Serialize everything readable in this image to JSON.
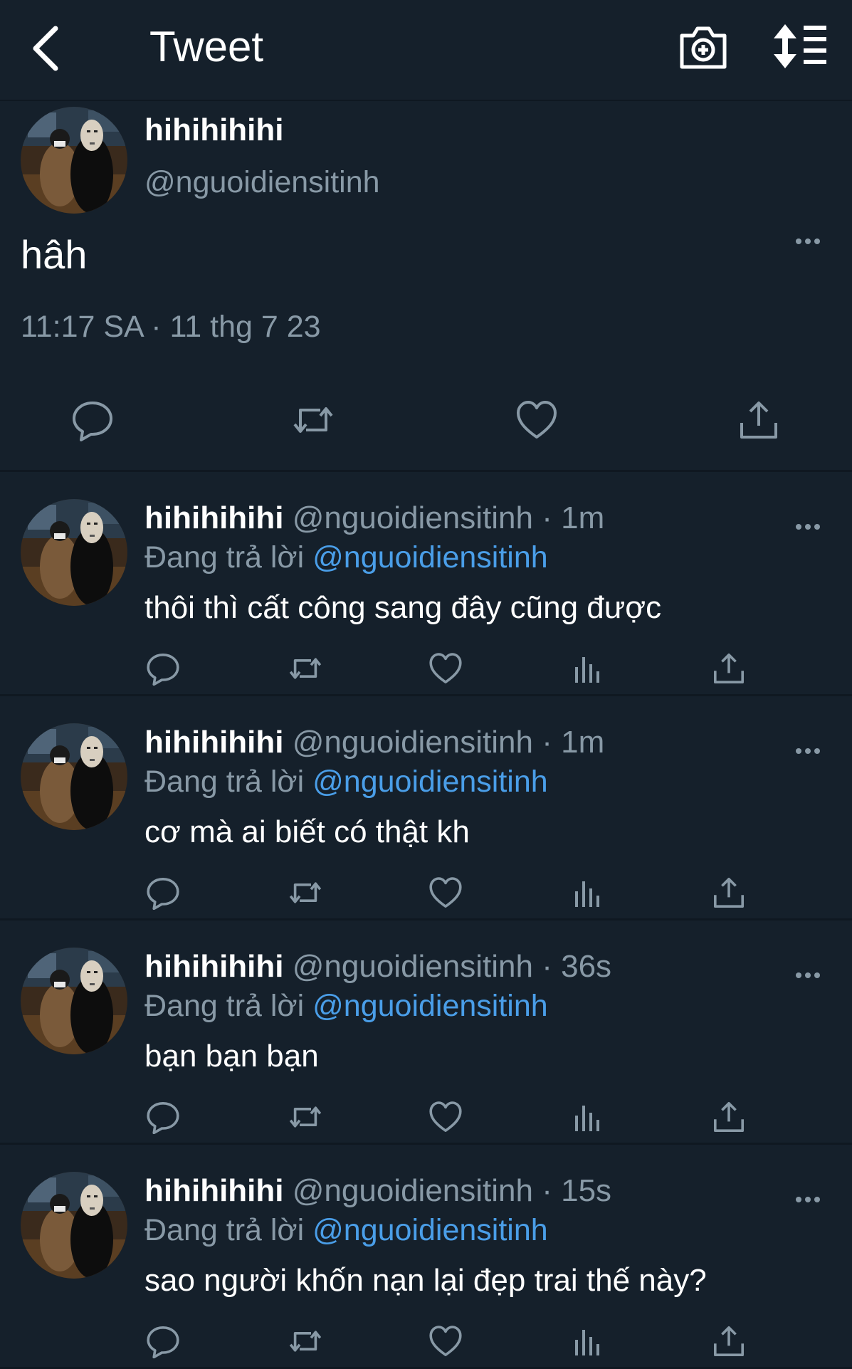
{
  "header": {
    "title": "Tweet",
    "back_icon": "chevron-left-icon",
    "camera_icon": "camera-plus-icon",
    "sort_icon": "sort-list-icon"
  },
  "colors": {
    "background": "#15202b",
    "text_primary": "#ffffff",
    "text_secondary": "#8899a6",
    "link": "#4a9ee8",
    "divider": "#38444d"
  },
  "main_tweet": {
    "name": "hihihihihi",
    "handle": "@nguoidiensitinh",
    "text": "hâh",
    "timestamp": "11:17 SA · 11 thg 7 23",
    "actions": [
      "reply-icon",
      "retweet-icon",
      "like-icon",
      "share-icon"
    ]
  },
  "replies": [
    {
      "name": "hihihihihi",
      "handle": "@nguoidiensitinh",
      "time": "1m",
      "reply_prefix": "Đang trả lời",
      "reply_to": "@nguoidiensitinh",
      "text": "thôi thì cất công sang đây cũng được"
    },
    {
      "name": "hihihihihi",
      "handle": "@nguoidiensitinh",
      "time": "1m",
      "reply_prefix": "Đang trả lời",
      "reply_to": "@nguoidiensitinh",
      "text": "cơ mà ai biết có thật kh"
    },
    {
      "name": "hihihihihi",
      "handle": "@nguoidiensitinh",
      "time": "36s",
      "reply_prefix": "Đang trả lời",
      "reply_to": "@nguoidiensitinh",
      "text": "bạn bạn bạn"
    },
    {
      "name": "hihihihihi",
      "handle": "@nguoidiensitinh",
      "time": "15s",
      "reply_prefix": "Đang trả lời",
      "reply_to": "@nguoidiensitinh",
      "text": "sao người khốn nạn lại đẹp trai thế này?"
    }
  ],
  "reply_separator": "·",
  "reply_actions": [
    "reply-icon",
    "retweet-icon",
    "like-icon",
    "analytics-icon",
    "share-icon"
  ]
}
